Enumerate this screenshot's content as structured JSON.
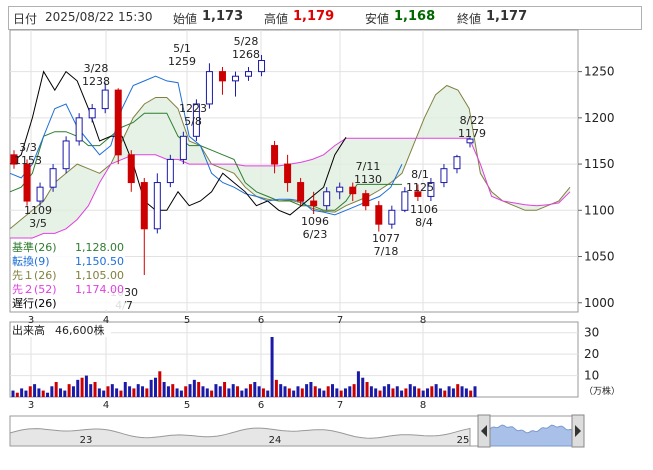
{
  "header": {
    "date_label": "日付",
    "datetime": "2025/08/22 15:30",
    "open_label": "始値",
    "open": "1,173",
    "high_label": "高値",
    "high": "1,179",
    "low_label": "安値",
    "low": "1,168",
    "close_label": "終値",
    "close": "1,177"
  },
  "colors": {
    "high": "#e00000",
    "low": "#006600",
    "up": "#1a1aa8",
    "down": "#cc0000",
    "kijun": "#2e7d2e",
    "tenkan": "#1e6fd9",
    "senkou1": "#808040",
    "senkou2": "#e040e0",
    "chikou": "#000000",
    "cloud": "#dfeedd"
  },
  "chart_data": [
    {
      "type": "candlestick",
      "y_ticks": [
        "1250",
        "1200",
        "1150",
        "1100",
        "1050",
        "1000"
      ],
      "ylim": [
        990,
        1295
      ],
      "x_month_labels": [
        "3",
        "4",
        "5",
        "6",
        "7",
        "8"
      ],
      "legend": [
        {
          "label": "基準(26)",
          "value": "1,128.00"
        },
        {
          "label": "転換(9)",
          "value": "1,150.50"
        },
        {
          "label": "先１(26)",
          "value": "1,105.00"
        },
        {
          "label": "先２(52)",
          "value": "1,174.00"
        },
        {
          "label": "遅行(26)",
          "value": ""
        }
      ],
      "annotations": [
        {
          "date": "3/3",
          "value": "1153"
        },
        {
          "date": "3/5",
          "value": "1109"
        },
        {
          "date": "3/28",
          "value": "1238"
        },
        {
          "date": "4/7",
          "value": "1030"
        },
        {
          "date": "5/1",
          "value": "1259"
        },
        {
          "date": "5/8",
          "value": "1223"
        },
        {
          "date": "5/28",
          "value": "1268"
        },
        {
          "date": "6/23",
          "value": "1096"
        },
        {
          "date": "7/11",
          "value": "1130"
        },
        {
          "date": "7/18",
          "value": "1077"
        },
        {
          "date": "8/1",
          "value": "1125"
        },
        {
          "date": "8/4",
          "value": "1106"
        },
        {
          "date": "8/22",
          "value": "1179"
        }
      ],
      "series_tenkan": [
        1140,
        1135,
        1150,
        1180,
        1210,
        1215,
        1190,
        1175,
        1160,
        1170,
        1210,
        1235,
        1240,
        1245,
        1240,
        1238,
        1180,
        1170,
        1140,
        1130,
        1125,
        1118,
        1115,
        1110,
        1112,
        1112,
        1110,
        1100,
        1098,
        1095,
        1100,
        1105,
        1110,
        1115,
        1125,
        1150
      ],
      "series_kijun": [
        1120,
        1125,
        1140,
        1180,
        1185,
        1185,
        1180,
        1170,
        1170,
        1180,
        1190,
        1195,
        1205,
        1205,
        1205,
        1180,
        1170,
        1170,
        1165,
        1160,
        1155,
        1130,
        1120,
        1115,
        1110,
        1110,
        1105,
        1105,
        1100,
        1100,
        1110,
        1128,
        1128,
        1128,
        1128,
        1128
      ],
      "series_senkou1": [
        1080,
        1090,
        1100,
        1110,
        1130,
        1140,
        1150,
        1145,
        1140,
        1150,
        1175,
        1200,
        1215,
        1222,
        1222,
        1210,
        1175,
        1170,
        1150,
        1145,
        1140,
        1125,
        1115,
        1112,
        1110,
        1111,
        1108,
        1102,
        1099,
        1098,
        1105,
        1110,
        1115,
        1122,
        1130,
        1140,
        1170,
        1200,
        1225,
        1235,
        1230,
        1210,
        1140,
        1120,
        1110,
        1105,
        1100,
        1100,
        1105,
        1110,
        1125
      ],
      "series_senkou2": [
        1070,
        1070,
        1070,
        1075,
        1075,
        1080,
        1090,
        1105,
        1130,
        1150,
        1155,
        1160,
        1160,
        1160,
        1155,
        1155,
        1150,
        1150,
        1150,
        1150,
        1150,
        1148,
        1148,
        1148,
        1148,
        1150,
        1152,
        1155,
        1160,
        1170,
        1178,
        1178,
        1178,
        1178,
        1178,
        1178,
        1178,
        1178,
        1178,
        1178,
        1178,
        1178,
        1150,
        1115,
        1110,
        1108,
        1106,
        1105,
        1106,
        1108,
        1120
      ],
      "series_chikou": [
        1150,
        1160,
        1200,
        1250,
        1230,
        1250,
        1240,
        1210,
        1175,
        1180,
        1180,
        1150,
        1110,
        1100,
        1100,
        1120,
        1105,
        1110,
        1120,
        1140,
        1130,
        1120,
        1105,
        1110,
        1100,
        1095,
        1105,
        1115,
        1125,
        1160,
        1179
      ],
      "candles": [
        [
          1160,
          1165,
          1145,
          1150
        ],
        [
          1150,
          1155,
          1105,
          1110
        ],
        [
          1110,
          1130,
          1105,
          1125
        ],
        [
          1125,
          1150,
          1120,
          1145
        ],
        [
          1145,
          1180,
          1140,
          1175
        ],
        [
          1175,
          1205,
          1170,
          1200
        ],
        [
          1200,
          1215,
          1195,
          1210
        ],
        [
          1210,
          1238,
          1205,
          1230
        ],
        [
          1230,
          1232,
          1150,
          1160
        ],
        [
          1160,
          1165,
          1120,
          1130
        ],
        [
          1130,
          1135,
          1030,
          1080
        ],
        [
          1080,
          1140,
          1075,
          1130
        ],
        [
          1130,
          1160,
          1125,
          1155
        ],
        [
          1155,
          1185,
          1150,
          1180
        ],
        [
          1180,
          1220,
          1175,
          1215
        ],
        [
          1215,
          1259,
          1210,
          1250
        ],
        [
          1250,
          1255,
          1225,
          1240
        ],
        [
          1240,
          1250,
          1223,
          1245
        ],
        [
          1245,
          1255,
          1240,
          1250
        ],
        [
          1250,
          1268,
          1245,
          1262
        ],
        [
          1170,
          1175,
          1140,
          1150
        ],
        [
          1150,
          1160,
          1120,
          1130
        ],
        [
          1130,
          1135,
          1105,
          1110
        ],
        [
          1110,
          1120,
          1096,
          1105
        ],
        [
          1105,
          1125,
          1100,
          1120
        ],
        [
          1120,
          1130,
          1112,
          1125
        ],
        [
          1125,
          1130,
          1110,
          1118
        ],
        [
          1118,
          1122,
          1100,
          1105
        ],
        [
          1105,
          1110,
          1077,
          1085
        ],
        [
          1085,
          1105,
          1080,
          1100
        ],
        [
          1100,
          1125,
          1098,
          1120
        ],
        [
          1120,
          1128,
          1110,
          1115
        ],
        [
          1115,
          1135,
          1110,
          1130
        ],
        [
          1130,
          1150,
          1125,
          1145
        ],
        [
          1145,
          1160,
          1140,
          1158
        ],
        [
          1173,
          1179,
          1168,
          1177
        ]
      ]
    },
    {
      "type": "bar",
      "title": "出来高",
      "title_value": "46,600株",
      "y_ticks": [
        "30",
        "20",
        "10"
      ],
      "ylim": [
        0,
        35
      ],
      "unit": "（万株）",
      "x_month_labels": [
        "3",
        "4",
        "5",
        "6",
        "7",
        "8"
      ],
      "values": [
        3,
        2,
        4,
        3,
        5,
        6,
        4,
        3,
        2,
        5,
        7,
        4,
        3,
        6,
        5,
        8,
        9,
        10,
        6,
        7,
        4,
        3,
        5,
        6,
        4,
        3,
        7,
        5,
        4,
        6,
        5,
        4,
        8,
        9,
        12,
        7,
        5,
        6,
        4,
        3,
        5,
        6,
        8,
        7,
        5,
        4,
        3,
        6,
        5,
        7,
        4,
        6,
        5,
        3,
        4,
        6,
        7,
        5,
        4,
        3,
        28,
        8,
        6,
        5,
        4,
        3,
        5,
        4,
        6,
        7,
        5,
        4,
        3,
        5,
        6,
        4,
        3,
        4,
        5,
        6,
        12,
        9,
        7,
        5,
        4,
        3,
        5,
        6,
        4,
        5,
        3,
        4,
        6,
        5,
        4,
        3,
        4,
        5,
        6,
        4,
        3,
        5,
        4,
        6,
        5,
        4,
        3,
        5
      ]
    },
    {
      "type": "area",
      "x_year_labels": [
        "23",
        "24",
        "25"
      ]
    }
  ]
}
